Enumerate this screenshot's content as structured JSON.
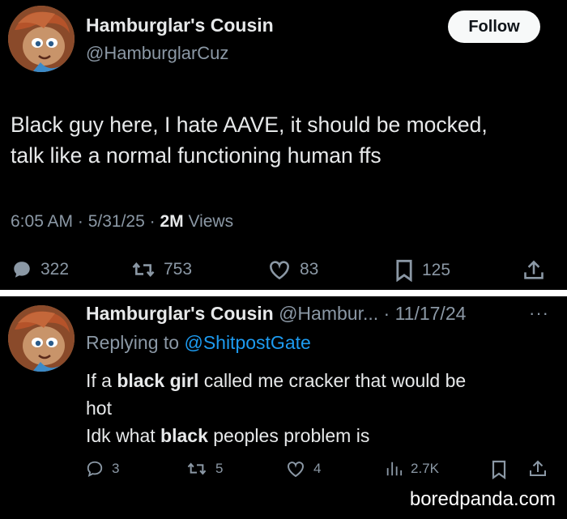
{
  "tweet1": {
    "name": "Hamburglar's Cousin",
    "handle": "@HamburglarCuz",
    "follow_label": "Follow",
    "text_line1": "Black guy here, I hate AAVE, it should be mocked,",
    "text_line2": "talk like a normal functioning human ffs",
    "time": "6:05 AM · 5/31/25 · ",
    "views_count": "2M",
    "views_label": " Views",
    "replies": "322",
    "reposts": "753",
    "likes": "83",
    "bookmarks": "125"
  },
  "tweet2": {
    "name": "Hamburglar's Cousin",
    "handle": "@Hambur...",
    "date": " · 11/17/24",
    "more": "···",
    "replying_prefix": "Replying to ",
    "replying_to": "@ShitpostGate",
    "line1_a": "If a ",
    "line1_b": "black girl",
    "line1_c": " called me cracker that would be",
    "line2": "hot",
    "line3_a": "Idk what ",
    "line3_b": "black",
    "line3_c": " peoples problem is",
    "replies": "3",
    "reposts": "5",
    "likes": "4",
    "views": "2.7K"
  },
  "watermark": "boredpanda.com",
  "icons": {
    "reply": "reply-icon",
    "repost": "repost-icon",
    "like": "heart-icon",
    "bookmark": "bookmark-icon",
    "share": "share-icon",
    "views": "views-icon"
  }
}
